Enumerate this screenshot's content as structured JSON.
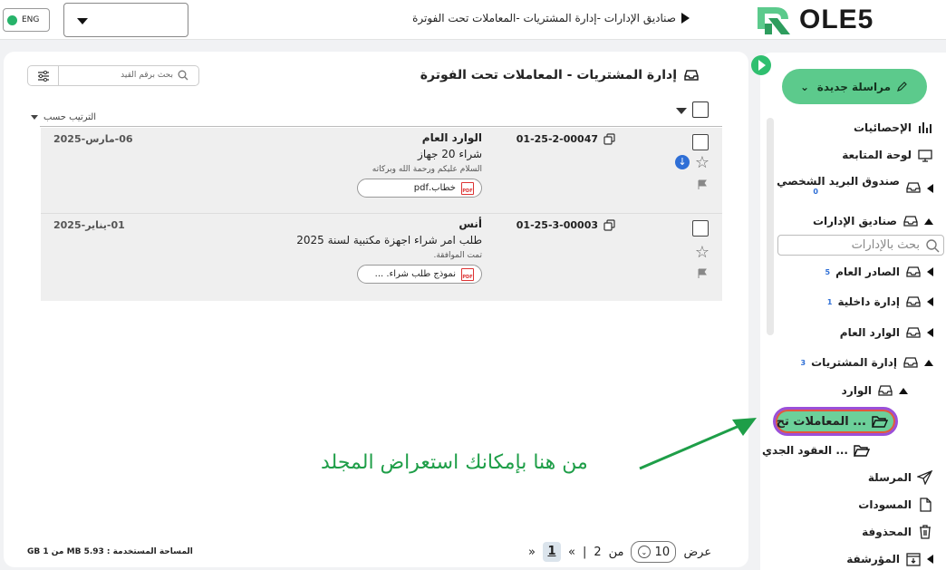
{
  "topbar": {
    "lang_label": "ENG",
    "breadcrumb": "صناديق الإدارات  -إدارة المشتريات -المعاملات تحت الفوترة",
    "logo_text": "OLE5"
  },
  "main": {
    "folder_title": "إدارة المشتريات - المعاملات تحت الفوترة",
    "search_placeholder": "بحث برقم القيد",
    "sort_label": "الترتيب حسب",
    "rows": [
      {
        "ref": "01-25-2-00047",
        "from": "الوارد العام",
        "subject": "شراء 20 جهاز",
        "preview": "السلام عليكم ورحمة الله وبركاته",
        "attachment": "خطاب.pdf",
        "date": "06-مارس-2025"
      },
      {
        "ref": "01-25-3-00003",
        "from": "أنس",
        "subject": "طلب امر شراء اجهزة مكتبية لسنة 2025",
        "preview": "تمت الموافقة.",
        "attachment": "نموذج طلب شراء. ...",
        "date": "01-يناير-2025"
      }
    ],
    "storage_label": "المساحة المستخدمة : 5.93 MB من 1 GB",
    "pager": {
      "show_label": "عرض",
      "page_size": "10",
      "of_label": "من",
      "total_pages": "2",
      "current_page": "1",
      "prev": "«",
      "next": "»",
      "sep": "|"
    }
  },
  "annotation": "من هنا بإمكانك استعراض المجلد",
  "sidebar": {
    "new_message": "مراسلة جديدة",
    "stats": "الإحصائيات",
    "dashboard": "لوحة المتابعة",
    "personal_mailbox": "صندوق البريد الشخصي",
    "personal_count": "0",
    "dept_boxes": "صناديق الإدارات",
    "search_placeholder": "بحث بالإدارات",
    "general_outgoing": "الصادر العام",
    "general_outgoing_count": "5",
    "internal_admin": "إدارة داخلية",
    "internal_admin_count": "1",
    "general_incoming": "الوارد العام",
    "procurement": "إدارة المشتريات",
    "procurement_count": "3",
    "incoming": "الوارد",
    "active_folder": "المعاملات تح ...",
    "contracts": "العقود الجدي ...",
    "sent": "المرسلة",
    "drafts": "المسودات",
    "deleted": "المحذوفة",
    "archived": "المؤرشفة"
  },
  "colors": {
    "accent": "#5cca8c",
    "annotation": "#1e9e48",
    "count": "#2f6fd6"
  }
}
